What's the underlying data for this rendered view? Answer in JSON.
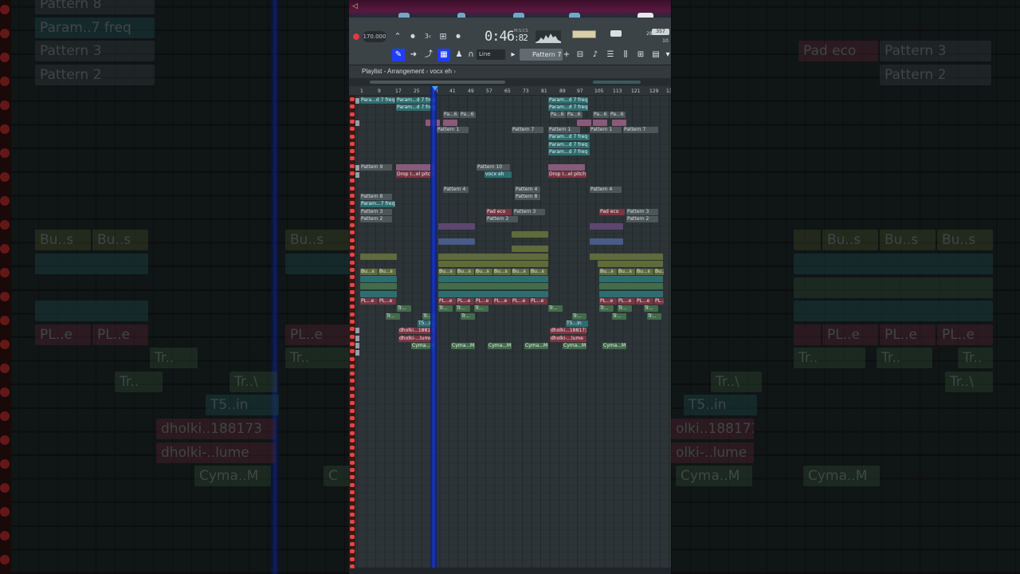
{
  "transport": {
    "tempo": "170.000",
    "time_main": "0:46",
    "time_frac": ":82",
    "time_sub_top": "M:S:CS",
    "time_sub_bottom": "",
    "cpu": "28",
    "ram": "357",
    "voices": "10",
    "snap": "Line",
    "pattern_selector": "Pattern 7"
  },
  "playlist": {
    "title": "Playlist - Arrangement",
    "separator": "›",
    "current": "vocx eh",
    "ruler": [
      "1",
      "9",
      "17",
      "25",
      "33",
      "41",
      "49",
      "57",
      "65",
      "73",
      "81",
      "89",
      "97",
      "105",
      "113",
      "121",
      "129",
      "13"
    ]
  },
  "clips": {
    "param_d7_freq": "Param...d 7 freq",
    "para_d7": "Para...d 7 freq",
    "pa6": "Pa...6",
    "pattern1": "Pattern 1",
    "pattern7": "Pattern 7",
    "pattern9": "Pattern 9",
    "pattern10": "Pattern 10",
    "drop_pitch": "Drop I...el pitch",
    "vocx_eh": "vocx eh",
    "pattern4": "Pattern 4",
    "pattern8": "Pattern 8",
    "param7": "Param...7 freq",
    "pattern3": "Pattern 3",
    "pattern2": "Pattern 2",
    "pad_eco": "Pad eco",
    "bus": "Bu...s",
    "ple": "PL...e",
    "tr": "Tr...",
    "t5": "T5...in",
    "dholki1": "dholki...188173",
    "dholki2": "dholki-...lume",
    "cyma": "Cyma...M"
  },
  "background_left": {
    "pattern8": "Pattern 8",
    "param7": "Param..7 freq",
    "pattern3": "Pattern 3",
    "pattern2": "Pattern 2",
    "bus": "Bu..s",
    "ple": "PL..e",
    "tr": "Tr..",
    "trb": "Tr..\\",
    "t5": "T5..in",
    "dholki1": "dholki..188173",
    "dholki2": "dholki-..lume",
    "cyma": "Cyma..M",
    "partial_c": "C"
  },
  "background_right": {
    "pad_eco": "Pad eco",
    "pattern3": "Pattern 3",
    "pattern2": "Pattern 2",
    "bus": "Bu..s",
    "ple": "PL..e",
    "tr": "Tr..",
    "trb": "Tr..\\",
    "t5": "T5..in",
    "dholki1": "olki..188173",
    "dholki2": "olki-..lume",
    "cyma": "Cyma..M"
  },
  "colors": {
    "accent": "#1f3dff",
    "record": "#e23a3a",
    "playhead": "#1636d8"
  }
}
